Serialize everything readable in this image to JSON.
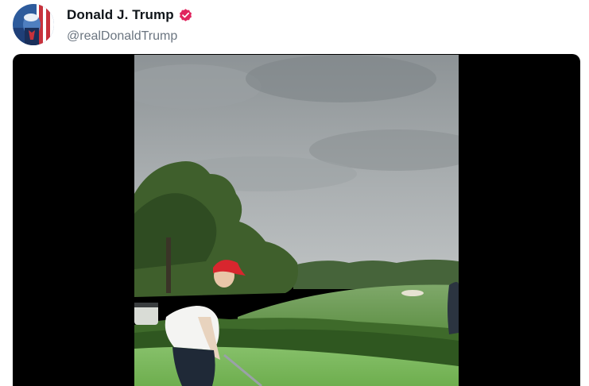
{
  "post": {
    "author": {
      "display_name": "Donald J. Trump",
      "handle": "@realDonaldTrump",
      "verified": true,
      "verified_icon": "verified-badge-icon",
      "verified_color": "#e0245e"
    },
    "media": {
      "type": "video",
      "letterbox_color": "#000000"
    }
  }
}
